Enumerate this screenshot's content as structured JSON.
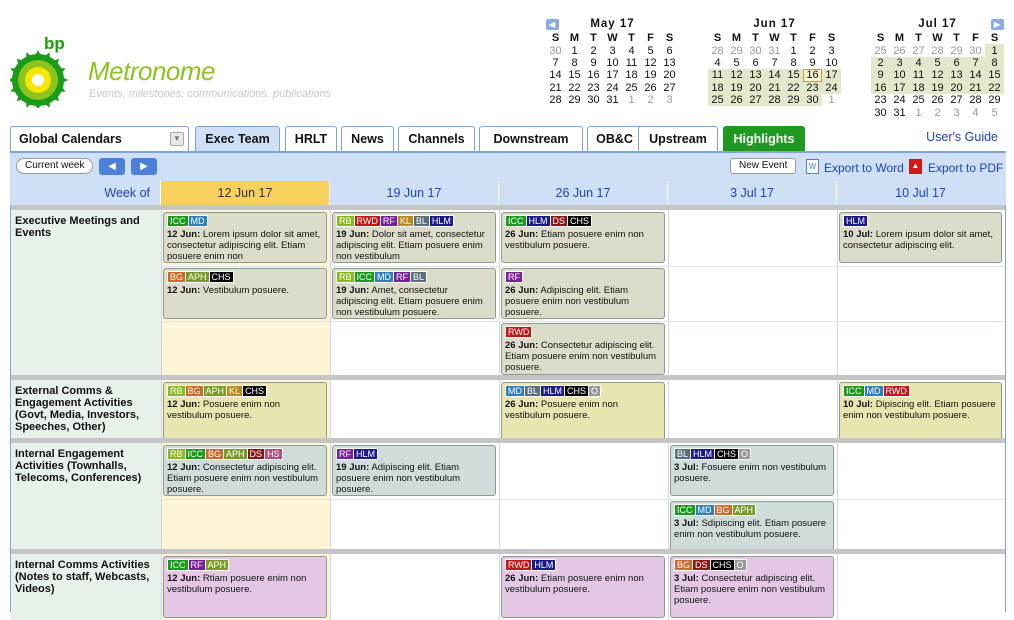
{
  "logo": {
    "mark": "bp",
    "name": "Metronome",
    "tagline": "Events, milestones, communications, publications"
  },
  "calendars": [
    {
      "title": "May 17",
      "dow": [
        "S",
        "M",
        "T",
        "W",
        "T",
        "F",
        "S"
      ],
      "weeks": [
        [
          "30",
          "1",
          "2",
          "3",
          "4",
          "5",
          "6"
        ],
        [
          "7",
          "8",
          "9",
          "10",
          "11",
          "12",
          "13"
        ],
        [
          "14",
          "15",
          "16",
          "17",
          "18",
          "19",
          "20"
        ],
        [
          "21",
          "22",
          "23",
          "24",
          "25",
          "26",
          "27"
        ],
        [
          "28",
          "29",
          "30",
          "31",
          "1",
          "2",
          "3"
        ]
      ]
    },
    {
      "title": "Jun 17",
      "dow": [
        "S",
        "M",
        "T",
        "W",
        "T",
        "F",
        "S"
      ],
      "weeks": [
        [
          "28",
          "29",
          "30",
          "31",
          "1",
          "2",
          "3"
        ],
        [
          "4",
          "5",
          "6",
          "7",
          "8",
          "9",
          "10"
        ],
        [
          "11",
          "12",
          "13",
          "14",
          "15",
          "16",
          "17"
        ],
        [
          "18",
          "19",
          "20",
          "21",
          "22",
          "23",
          "24"
        ],
        [
          "25",
          "26",
          "27",
          "28",
          "29",
          "30",
          "1"
        ]
      ]
    },
    {
      "title": "Jul 17",
      "dow": [
        "S",
        "M",
        "T",
        "W",
        "T",
        "F",
        "S"
      ],
      "weeks": [
        [
          "25",
          "26",
          "27",
          "28",
          "29",
          "30",
          "1"
        ],
        [
          "2",
          "3",
          "4",
          "5",
          "6",
          "7",
          "8"
        ],
        [
          "9",
          "10",
          "11",
          "12",
          "13",
          "14",
          "15"
        ],
        [
          "16",
          "17",
          "18",
          "19",
          "20",
          "21",
          "22"
        ],
        [
          "23",
          "24",
          "25",
          "26",
          "27",
          "28",
          "29"
        ],
        [
          "30",
          "31",
          "1",
          "2",
          "3",
          "4",
          "5"
        ]
      ]
    }
  ],
  "tabs": [
    "Global Calendars",
    "Exec Team",
    "HRLT",
    "News",
    "Channels",
    "Downstream",
    "OB&C",
    "Upstream",
    "Highlights"
  ],
  "user_guide": "User's Guide",
  "toolbar": {
    "current_week": "Current week",
    "prev": "◀",
    "next": "▶",
    "new_event": "New Event",
    "export_word": "Export to Word",
    "export_pdf": "Export to PDF"
  },
  "week_label": "Week of",
  "weeks": [
    "12 Jun 17",
    "19 Jun 17",
    "26 Jun 17",
    "3 Jul 17",
    "10 Jul 17"
  ],
  "tag_colors": {
    "ICC": "#1a9b1a",
    "MD": "#2f7fbf",
    "RB": "#8ab820",
    "RWD": "#c01818",
    "RF": "#7a1f9a",
    "KL": "#b88a20",
    "BL": "#5a6f7f",
    "HLM": "#1a1a8a",
    "DS": "#8a1818",
    "CHS": "#000000",
    "BG": "#d0682a",
    "APH": "#7a9a2a",
    "HS": "#b0507a",
    "O": "#999999"
  },
  "sections": [
    {
      "label": "Executive Meetings and Events",
      "events": [
        {
          "week": 0,
          "slot": 0,
          "tags": [
            "ICC",
            "MD"
          ],
          "date": "12 Jun:",
          "text": "Lorem ipsum dolor sit amet, consectetur adipiscing elit. Etiam posuere enim non"
        },
        {
          "week": 0,
          "slot": 1,
          "tags": [
            "BG",
            "APH",
            "CHS"
          ],
          "date": "12 Jun:",
          "text": "Vestibulum posuere."
        },
        {
          "week": 1,
          "slot": 0,
          "tags": [
            "RB",
            "RWD",
            "RF",
            "KL",
            "BL",
            "HLM"
          ],
          "date": "19 Jun:",
          "text": "Dolor sit amet, consectetur adipiscing elit. Etiam posuere enim non vestibulum"
        },
        {
          "week": 1,
          "slot": 1,
          "tags": [
            "RB",
            "ICC",
            "MD",
            "RF",
            "BL"
          ],
          "date": "19 Jun:",
          "text": "Amet, consectetur adipiscing elit. Etiam posuere enim non vestibulum posuere."
        },
        {
          "week": 2,
          "slot": 0,
          "tags": [
            "ICC",
            "HLM",
            "DS",
            "CHS"
          ],
          "date": "26 Jun:",
          "text": "Etiam posuere enim non vestibulum posuere."
        },
        {
          "week": 2,
          "slot": 1,
          "tags": [
            "RF"
          ],
          "date": "26 Jun:",
          "text": "Adipiscing elit. Etiam posuere enim non vestibulum posuere."
        },
        {
          "week": 2,
          "slot": 2,
          "tags": [
            "RWD"
          ],
          "date": "26 Jun:",
          "text": "Consectetur adipiscing elit. Etiam posuere enim non vestibulum posuere."
        },
        {
          "week": 4,
          "slot": 0,
          "tags": [
            "HLM"
          ],
          "date": "10 Jul:",
          "text": "Lorem ipsum dolor sit amet, consectetur adipiscing elit."
        }
      ]
    },
    {
      "label": "External Comms & Engagement Activities (Govt, Media, Investors, Speeches, Other)",
      "events": [
        {
          "week": 0,
          "slot": 0,
          "tags": [
            "RB",
            "BG",
            "APH",
            "KL",
            "CHS"
          ],
          "date": "12 Jun:",
          "text": "Posuere enim non vestibulum posuere."
        },
        {
          "week": 2,
          "slot": 0,
          "tags": [
            "MD",
            "BL",
            "HLM",
            "CHS",
            "O"
          ],
          "date": "26 Jun:",
          "text": "Posuere enim non vestibulum posuere."
        },
        {
          "week": 4,
          "slot": 0,
          "tags": [
            "ICC",
            "MD",
            "RWD"
          ],
          "date": "10 Jul:",
          "text": "Dipiscing elit. Etiam posuere enim non vestibulum posuere."
        }
      ]
    },
    {
      "label": "Internal Engagement Activities (Townhalls, Telecoms, Conferences)",
      "events": [
        {
          "week": 0,
          "slot": 0,
          "tags": [
            "RB",
            "ICC",
            "BG",
            "APH",
            "DS",
            "HS"
          ],
          "date": "12 Jun:",
          "text": "Consectetur adipiscing elit. Etiam posuere enim non vestibulum posuere."
        },
        {
          "week": 1,
          "slot": 0,
          "tags": [
            "RF",
            "HLM"
          ],
          "date": "19 Jun:",
          "text": "Adipiscing elit. Etiam posuere enim non vestibulum posuere."
        },
        {
          "week": 3,
          "slot": 0,
          "tags": [
            "BL",
            "HLM",
            "CHS",
            "O"
          ],
          "date": "3 Jul:",
          "text": "Fosuere enim non vestibulum posuere."
        },
        {
          "week": 3,
          "slot": 1,
          "tags": [
            "ICC",
            "MD",
            "BG",
            "APH"
          ],
          "date": "3 Jul:",
          "text": "Sdipiscing elit. Etiam posuere enim non vestibulum posuere."
        }
      ]
    },
    {
      "label": "Internal Comms Activities (Notes to staff, Webcasts, Videos)",
      "events": [
        {
          "week": 0,
          "slot": 0,
          "tags": [
            "ICC",
            "RF",
            "APH"
          ],
          "date": "12 Jun:",
          "text": "Rtiam posuere enim non vestibulum posuere."
        },
        {
          "week": 2,
          "slot": 0,
          "tags": [
            "RWD",
            "HLM"
          ],
          "date": "26 Jun:",
          "text": "Etiam posuere enim non vestibulum posuere."
        },
        {
          "week": 3,
          "slot": 0,
          "tags": [
            "BG",
            "DS",
            "CHS",
            "O"
          ],
          "date": "3 Jul:",
          "text": "Consectetur adipiscing elit. Etiam posuere enim non vestibulum posuere."
        }
      ]
    }
  ]
}
